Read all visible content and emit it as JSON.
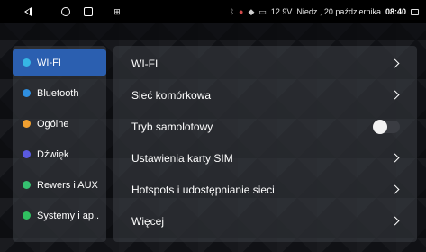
{
  "statusbar": {
    "icons": [
      "bluetooth-icon",
      "record-icon",
      "wifi-icon",
      "battery-icon"
    ],
    "voltage": "12.9V",
    "date": "Niedz., 20 października",
    "time": "08:40"
  },
  "sidebar": {
    "items": [
      {
        "label": "WI-FI",
        "color": "#36b6e5",
        "active": true
      },
      {
        "label": "Bluetooth",
        "color": "#2f8fe0",
        "active": false
      },
      {
        "label": "Ogólne",
        "color": "#f0a030",
        "active": false
      },
      {
        "label": "Dźwięk",
        "color": "#5a5ae0",
        "active": false
      },
      {
        "label": "Rewers i AUX",
        "color": "#35c070",
        "active": false
      },
      {
        "label": "Systemy i ap..",
        "color": "#30c060",
        "active": false
      }
    ]
  },
  "settings": {
    "rows": [
      {
        "label": "WI-FI",
        "control": "chevron"
      },
      {
        "label": "Sieć komórkowa",
        "control": "chevron"
      },
      {
        "label": "Tryb samolotowy",
        "control": "toggle",
        "value": false
      },
      {
        "label": "Ustawienia karty SIM",
        "control": "chevron"
      },
      {
        "label": "Hotspots i udostępnianie sieci",
        "control": "chevron"
      },
      {
        "label": "Więcej",
        "control": "chevron"
      }
    ]
  }
}
